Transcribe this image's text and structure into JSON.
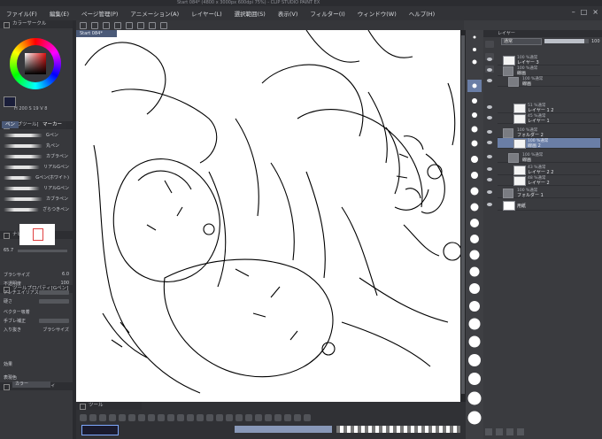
{
  "titlebar": {
    "text": "Start 084* (4800 x 3000px 600dpi 75%) - CLIP STUDIO PAINT EX"
  },
  "menu": [
    "ファイル(F)",
    "編集(E)",
    "ページ管理(P)",
    "アニメーション(A)",
    "レイヤー(L)",
    "選択範囲(S)",
    "表示(V)",
    "フィルター(I)",
    "ウィンドウ(W)",
    "ヘルプ(H)"
  ],
  "window_controls": [
    "–",
    "□",
    "×"
  ],
  "doc_tab": "Start 084*",
  "color_panel": {
    "label": "カラーサークル",
    "hsv": "H 200 S 19 V 8"
  },
  "sub_tool": {
    "header": "サブツール[ペン]",
    "tabs": [
      "ペン",
      "マーカー"
    ],
    "brushes": [
      "Gペン",
      "丸ペン",
      "カブラペン",
      "リアルGペン",
      "Gペン(ホワイト)",
      "リアルGペン",
      "カブラペン",
      "ざらつきペン"
    ]
  },
  "navigator": {
    "header": "ナビゲーター",
    "zoom": "65.7"
  },
  "tool_property": {
    "header": "ツールプロパティ[Gペン]",
    "rows": [
      "ブラシサイズ",
      "不透明度",
      "アンチエイリアス",
      "硬さ",
      "ベクター吸着",
      "手ブレ補正",
      "入り抜き"
    ],
    "values": [
      "6.0",
      "100",
      "",
      "",
      "",
      "",
      "ブラシサイズ"
    ]
  },
  "layer_property": {
    "header": "レイヤープロパティ",
    "effect": "効果",
    "color_label": "表現色",
    "color_value": "カラー"
  },
  "layer_panel": {
    "header": "レイヤー",
    "blend": "通常",
    "opacity": "100",
    "layers": [
      {
        "pct": "100 %通常",
        "name": "レイヤー 3"
      },
      {
        "pct": "100 %通常",
        "name": "線画"
      },
      {
        "pct": "100 %通常",
        "name": "線画"
      },
      {
        "pct": "51 %通常",
        "name": "レイヤー 1 2"
      },
      {
        "pct": "45 %通常",
        "name": "レイヤー 1"
      },
      {
        "pct": "100 %通常",
        "name": "フォルダー 2"
      },
      {
        "pct": "100 %通常",
        "name": "線画 2"
      },
      {
        "pct": "100 %通常",
        "name": "線画"
      },
      {
        "pct": "43 %通常",
        "name": "レイヤー 2 2"
      },
      {
        "pct": "48 %通常",
        "name": "レイヤー 2"
      },
      {
        "pct": "100 %通常",
        "name": "フォルダー 1"
      },
      {
        "pct": "",
        "name": "用紙"
      }
    ]
  },
  "bottom": {
    "header": "ツール"
  },
  "colors": {
    "accent": "#6a7ea6",
    "selected_tab": "#4b5a78"
  }
}
